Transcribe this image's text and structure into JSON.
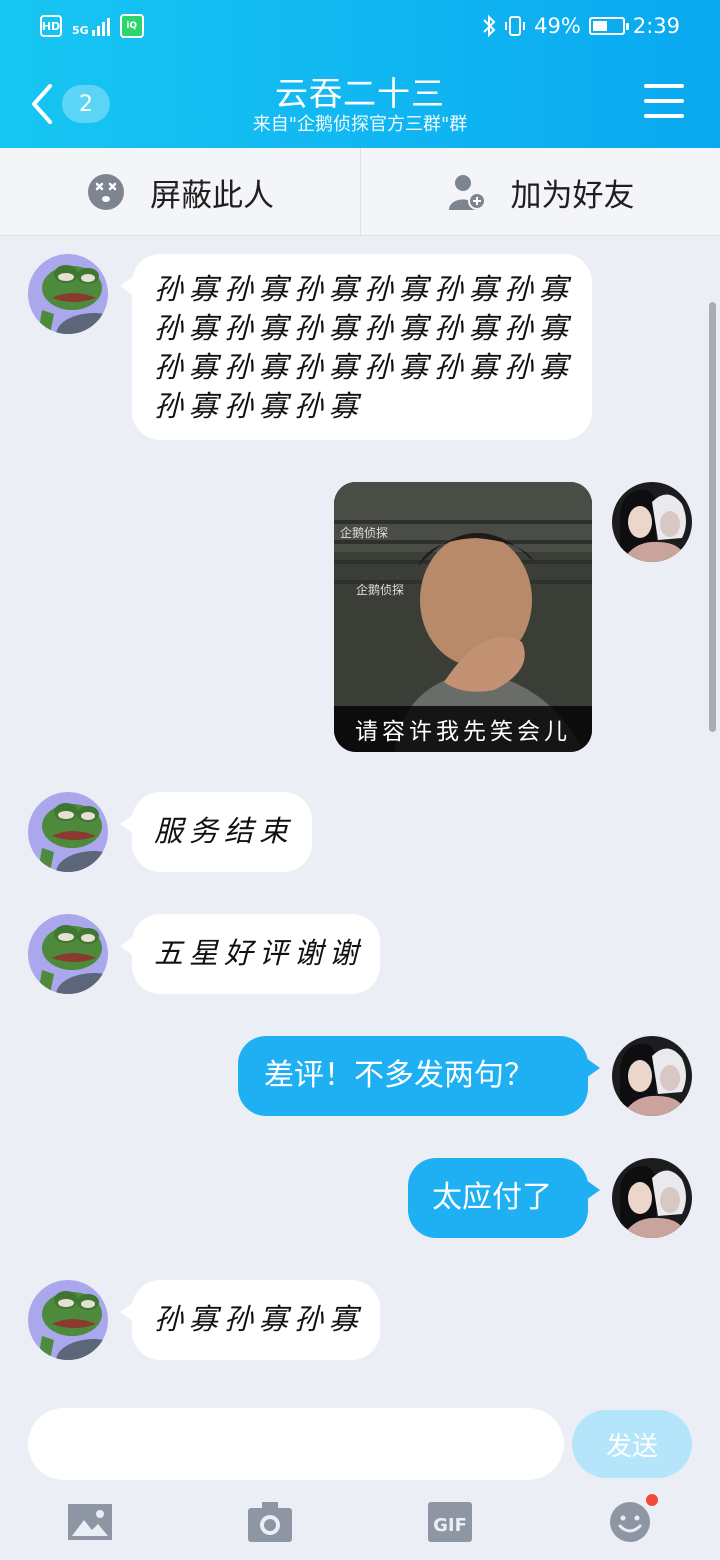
{
  "status_bar": {
    "hd": "HD",
    "network": "5G",
    "app": "爱奇艺",
    "battery": "49%",
    "battery_level": 0.49,
    "time": "2:39"
  },
  "header": {
    "back_count": "2",
    "title": "云吞二十三",
    "subtitle": "来自\"企鹅侦探官方三群\"群"
  },
  "actions": {
    "block_label": "屏蔽此人",
    "add_friend_label": "加为好友"
  },
  "messages": [
    {
      "side": "left",
      "lines": [
        "孙寡孙寡孙寡孙寡孙寡孙寡",
        "孙寡孙寡孙寡孙寡孙寡孙寡",
        "孙寡孙寡孙寡孙寡孙寡孙寡",
        "孙寡孙寡孙寡"
      ]
    },
    {
      "side": "right",
      "type": "image",
      "caption": "请容许我先笑会儿"
    },
    {
      "side": "left",
      "text": "服务结束"
    },
    {
      "side": "left",
      "text": "五星好评谢谢"
    },
    {
      "side": "right",
      "text": "差评！不多发两句？"
    },
    {
      "side": "right",
      "text": "太应付了"
    },
    {
      "side": "left",
      "text": "孙寡孙寡孙寡"
    }
  ],
  "input": {
    "placeholder": "",
    "send_label": "发送"
  },
  "toolbar": {
    "icons": [
      "image-icon",
      "camera-icon",
      "gif-icon",
      "emoji-icon"
    ],
    "gif_label": "GIF"
  },
  "colors": {
    "header_gradient_start": "#17c6f2",
    "header_gradient_end": "#0aa8f0",
    "self_bubble": "#1fb0f3",
    "background": "#ebeef5",
    "send_button": "#b4e5fa",
    "badge": "#f24b3c"
  }
}
